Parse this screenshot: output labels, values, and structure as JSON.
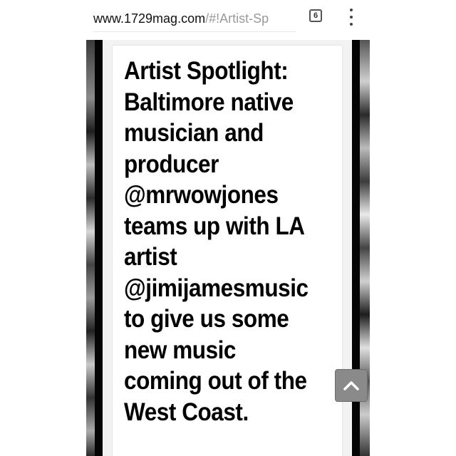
{
  "browser": {
    "url_domain": "www.1729mag.com",
    "url_path": "/#!Artist-Sp",
    "tab_count": "6",
    "menu_icon": "overflow-menu-icon"
  },
  "article": {
    "headline": "Artist Spotlight:\nBaltimore native\nmusician and\nproducer\n@mrwowjones\nteams up with LA\nartist\n@jimijamesmusic\nto give us some\nnew music\ncoming out of the\nWest Coast."
  },
  "controls": {
    "scroll_top_icon": "chevron-up-icon"
  },
  "colors": {
    "frame": "#050505",
    "card": "#ffffff",
    "scroll_button": "#8a8a8a"
  }
}
